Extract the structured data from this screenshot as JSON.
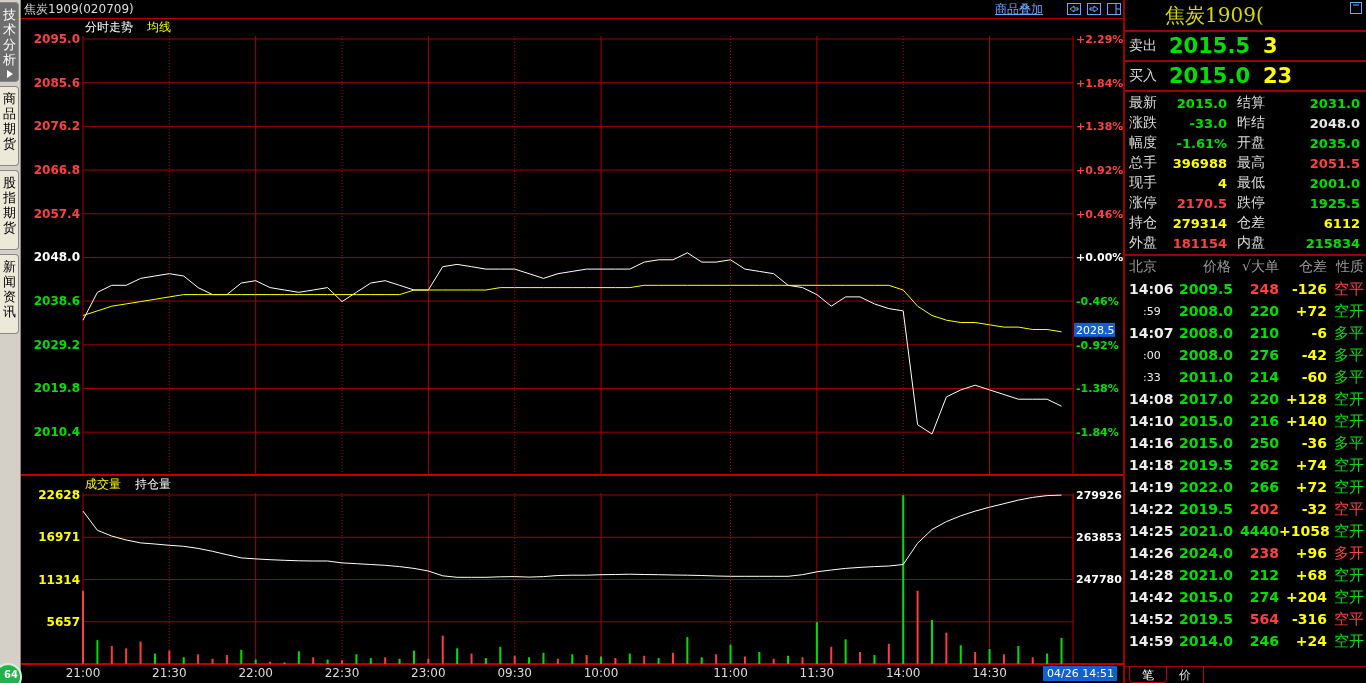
{
  "side_tabs": [
    {
      "label": "技术分析",
      "selected": true
    },
    {
      "label": "商品期货",
      "selected": false
    },
    {
      "label": "股指期货",
      "selected": false
    },
    {
      "label": "新闻资讯",
      "selected": false
    }
  ],
  "float_badge": "64",
  "header": {
    "title": "焦炭1909(020709)",
    "link": "商品叠加"
  },
  "price_panel": {
    "percent_labels": [
      {
        "text": "+2.29%",
        "color": "#ff4040"
      },
      {
        "text": "+1.84%",
        "color": "#ff4040"
      },
      {
        "text": "+1.38%",
        "color": "#ff4040"
      },
      {
        "text": "+0.92%",
        "color": "#ff4040"
      },
      {
        "text": "+0.46%",
        "color": "#ff4040"
      },
      {
        "text": "+0.00%",
        "color": "#ffffff"
      },
      {
        "text": "-0.46%",
        "color": "#00e000"
      },
      {
        "text": "-0.92%",
        "color": "#00e000"
      },
      {
        "text": "-1.38%",
        "color": "#00e000"
      },
      {
        "text": "-1.84%",
        "color": "#00e000"
      }
    ],
    "last_price_badge": "2028.5",
    "chart_data": {
      "type": "line",
      "series": [
        {
          "name": "分时走势",
          "color": "#ffffff",
          "values": [
            2034.5,
            2040.5,
            2042.0,
            2042.0,
            2043.5,
            2044.0,
            2044.5,
            2044.0,
            2041.5,
            2040.0,
            2040.0,
            2042.5,
            2043.0,
            2041.5,
            2041.0,
            2040.5,
            2041.0,
            2041.5,
            2038.5,
            2040.5,
            2042.5,
            2043.0,
            2042.0,
            2041.0,
            2041.0,
            2046.0,
            2046.5,
            2046.0,
            2045.5,
            2045.5,
            2045.5,
            2044.5,
            2043.5,
            2044.5,
            2045.0,
            2045.5,
            2045.5,
            2045.5,
            2045.5,
            2047.0,
            2047.5,
            2047.5,
            2049.0,
            2047.0,
            2047.0,
            2047.5,
            2045.5,
            2045.0,
            2044.5,
            2042.0,
            2041.5,
            2040.0,
            2037.5,
            2039.5,
            2039.5,
            2038.0,
            2037.0,
            2036.5,
            2012.0,
            2010.0,
            2018.0,
            2019.5,
            2020.5,
            2019.5,
            2018.5,
            2017.5,
            2017.5,
            2017.5,
            2016.0
          ]
        },
        {
          "name": "均线",
          "color": "#ffff00",
          "values": [
            2035.5,
            2036.5,
            2037.5,
            2038.0,
            2038.5,
            2039.0,
            2039.5,
            2040.0,
            2040.0,
            2040.0,
            2040.0,
            2040.0,
            2040.0,
            2040.0,
            2040.0,
            2040.0,
            2040.0,
            2040.0,
            2040.0,
            2040.0,
            2040.0,
            2040.0,
            2040.0,
            2041.0,
            2041.0,
            2041.0,
            2041.0,
            2041.0,
            2041.0,
            2041.5,
            2041.5,
            2041.5,
            2041.5,
            2041.5,
            2041.5,
            2041.5,
            2041.5,
            2041.5,
            2041.5,
            2042.0,
            2042.0,
            2042.0,
            2042.0,
            2042.0,
            2042.0,
            2042.0,
            2042.0,
            2042.0,
            2042.0,
            2042.0,
            2042.0,
            2042.0,
            2042.0,
            2042.0,
            2042.0,
            2042.0,
            2042.0,
            2041.0,
            2037.5,
            2035.5,
            2034.5,
            2034.0,
            2034.0,
            2033.5,
            2033.0,
            2033.0,
            2032.5,
            2032.5,
            2032.0
          ]
        }
      ],
      "grid": true,
      "ylim": [
        2001.4,
        2095.65
      ],
      "yticks": [
        {
          "value": 2095.0,
          "label": "2095.0"
        },
        {
          "value": 2085.6,
          "label": "2085.6"
        },
        {
          "value": 2076.2,
          "label": "2076.2"
        },
        {
          "value": 2066.8,
          "label": "2066.8"
        },
        {
          "value": 2057.4,
          "label": "2057.4"
        },
        {
          "value": 2048.0,
          "label": "2048.0"
        },
        {
          "value": 2038.6,
          "label": "2038.6"
        },
        {
          "value": 2029.2,
          "label": "2029.2"
        },
        {
          "value": 2019.8,
          "label": "2019.8"
        },
        {
          "value": 2010.4,
          "label": "2010.4"
        }
      ]
    }
  },
  "volume_panel": {
    "chart_data": {
      "type": "bar",
      "title": "成交量",
      "categories": [
        "21:00",
        null,
        null,
        null,
        null,
        null,
        "21:30",
        null,
        null,
        null,
        null,
        null,
        "22:00",
        null,
        null,
        null,
        null,
        null,
        "22:30",
        null,
        null,
        null,
        null,
        null,
        "23:00",
        null,
        null,
        null,
        null,
        null,
        "09:30",
        null,
        null,
        null,
        null,
        null,
        "10:00",
        null,
        null,
        null,
        null,
        null,
        null,
        null,
        null,
        "11:00",
        null,
        null,
        null,
        null,
        null,
        "11:30",
        null,
        null,
        null,
        null,
        null,
        "14:00",
        null,
        null,
        null,
        null,
        null,
        "14:30",
        null,
        null,
        null,
        null,
        null
      ],
      "series": [
        {
          "color": "#ff3c3c",
          "values": [
            9800,
            null,
            2400,
            2100,
            3000,
            null,
            1800,
            null,
            1300,
            700,
            1200,
            null,
            null,
            300,
            null,
            null,
            900,
            null,
            500,
            null,
            null,
            900,
            null,
            null,
            700,
            3800,
            null,
            1400,
            null,
            null,
            1100,
            null,
            null,
            700,
            null,
            1200,
            null,
            800,
            null,
            1100,
            null,
            1500,
            null,
            null,
            1300,
            null,
            1000,
            null,
            700,
            null,
            900,
            null,
            2300,
            null,
            1600,
            null,
            2700,
            null,
            9800,
            null,
            4200,
            null,
            1600,
            null,
            1300,
            null,
            900,
            null,
            null
          ]
        },
        {
          "color": "#00e000",
          "values": [
            null,
            3200,
            null,
            null,
            null,
            1400,
            null,
            900,
            null,
            null,
            null,
            1900,
            600,
            null,
            200,
            1700,
            null,
            600,
            null,
            1300,
            800,
            null,
            700,
            1800,
            null,
            null,
            2100,
            null,
            800,
            2300,
            null,
            900,
            1500,
            null,
            1300,
            null,
            1000,
            null,
            1400,
            null,
            800,
            null,
            3600,
            900,
            null,
            2600,
            null,
            1600,
            null,
            1100,
            null,
            5600,
            null,
            3300,
            null,
            1200,
            null,
            22600,
            null,
            5900,
            null,
            2500,
            null,
            2000,
            null,
            2400,
            null,
            1400,
            3500
          ]
        }
      ],
      "stacked": true,
      "grid": true,
      "ylim": [
        0,
        22896
      ],
      "yticks": [
        22628,
        16971,
        11314,
        5657
      ]
    },
    "time_badge": "04/26 14:51"
  },
  "open_interest_panel": {
    "chart_data": {
      "type": "line",
      "title": "持仓量",
      "series": [
        {
          "color": "#ffffff",
          "values": [
            273800,
            266500,
            264300,
            262800,
            261700,
            261300,
            260800,
            260400,
            259600,
            258500,
            257200,
            256000,
            255600,
            255300,
            255100,
            254900,
            254800,
            254800,
            254100,
            253800,
            253500,
            253200,
            252700,
            252000,
            251000,
            249200,
            248600,
            248600,
            248600,
            248800,
            248900,
            248700,
            248900,
            249300,
            249400,
            249400,
            249600,
            249700,
            249800,
            249700,
            249600,
            249500,
            249400,
            249300,
            249100,
            249000,
            249000,
            249000,
            249000,
            249000,
            249600,
            250700,
            251400,
            252000,
            252400,
            252700,
            252900,
            253500,
            261600,
            266800,
            269800,
            272000,
            273800,
            275300,
            276600,
            278000,
            279000,
            279700,
            279900
          ]
        }
      ],
      "ylim": [
        247780,
        279926
      ],
      "yticks": [
        279926,
        263853,
        247780
      ]
    }
  },
  "quote": {
    "title": "焦炭1909(",
    "sell": {
      "label": "卖出",
      "price": "2015.5",
      "volume": "3"
    },
    "buy": {
      "label": "买入",
      "price": "2015.0",
      "volume": "23"
    },
    "stats": [
      {
        "label": "最新",
        "value": "2015.0",
        "color": "#00e000"
      },
      {
        "label": "结算",
        "value": "2031.0",
        "color": "#00e000"
      },
      {
        "label": "涨跌",
        "value": "-33.0",
        "color": "#00e000"
      },
      {
        "label": "昨结",
        "value": "2048.0",
        "color": "#e8e8e8"
      },
      {
        "label": "幅度",
        "value": "-1.61%",
        "color": "#00e000"
      },
      {
        "label": "开盘",
        "value": "2035.0",
        "color": "#00e000"
      },
      {
        "label": "总手",
        "value": "396988",
        "color": "#ffff00"
      },
      {
        "label": "最高",
        "value": "2051.5",
        "color": "#ff4040"
      },
      {
        "label": "现手",
        "value": "4",
        "color": "#ffff00"
      },
      {
        "label": "最低",
        "value": "2001.0",
        "color": "#00e000"
      },
      {
        "label": "涨停",
        "value": "2170.5",
        "color": "#ff4040"
      },
      {
        "label": "跌停",
        "value": "1925.5",
        "color": "#00e000"
      },
      {
        "label": "持仓",
        "value": "279314",
        "color": "#ffff00"
      },
      {
        "label": "仓差",
        "value": "6112",
        "color": "#ffff00"
      },
      {
        "label": "外盘",
        "value": "181154",
        "color": "#ff4040"
      },
      {
        "label": "内盘",
        "value": "215834",
        "color": "#00e000"
      }
    ],
    "tick_columns": [
      "北京",
      "价格",
      "√大单",
      "仓差",
      "性质"
    ],
    "ticks": [
      {
        "time": "14:06",
        "kind": "minute",
        "price": "2009.5",
        "volume": "248",
        "change": "-126",
        "nature": "空平",
        "color": "#ff4040"
      },
      {
        "time": ":59",
        "kind": "second",
        "price": "2008.0",
        "volume": "220",
        "change": "+72",
        "nature": "空开",
        "color": "#00e000"
      },
      {
        "time": "14:07",
        "kind": "minute",
        "price": "2008.0",
        "volume": "210",
        "change": "-6",
        "nature": "多平",
        "color": "#00e000"
      },
      {
        "time": ":00",
        "kind": "second",
        "price": "2008.0",
        "volume": "276",
        "change": "-42",
        "nature": "多平",
        "color": "#00e000"
      },
      {
        "time": ":33",
        "kind": "second",
        "price": "2011.0",
        "volume": "214",
        "change": "-60",
        "nature": "多平",
        "color": "#00e000"
      },
      {
        "time": "14:08",
        "kind": "minute",
        "price": "2017.0",
        "volume": "220",
        "change": "+128",
        "nature": "空开",
        "color": "#00e000"
      },
      {
        "time": "14:10",
        "kind": "minute",
        "price": "2015.0",
        "volume": "216",
        "change": "+140",
        "nature": "空开",
        "color": "#00e000"
      },
      {
        "time": "14:16",
        "kind": "minute",
        "price": "2015.0",
        "volume": "250",
        "change": "-36",
        "nature": "多平",
        "color": "#00e000"
      },
      {
        "time": "14:18",
        "kind": "minute",
        "price": "2019.5",
        "volume": "262",
        "change": "+74",
        "nature": "空开",
        "color": "#00e000"
      },
      {
        "time": "14:19",
        "kind": "minute",
        "price": "2022.0",
        "volume": "266",
        "change": "+72",
        "nature": "空开",
        "color": "#00e000"
      },
      {
        "time": "14:22",
        "kind": "minute",
        "price": "2019.5",
        "volume": "202",
        "change": "-32",
        "nature": "空平",
        "color": "#ff4040"
      },
      {
        "time": "14:25",
        "kind": "minute",
        "price": "2021.0",
        "volume": "4440",
        "change": "+1058",
        "nature": "空开",
        "color": "#00e000"
      },
      {
        "time": "14:26",
        "kind": "minute",
        "price": "2024.0",
        "volume": "238",
        "change": "+96",
        "nature": "多开",
        "color": "#ff4040"
      },
      {
        "time": "14:28",
        "kind": "minute",
        "price": "2021.0",
        "volume": "212",
        "change": "+68",
        "nature": "空开",
        "color": "#00e000"
      },
      {
        "time": "14:42",
        "kind": "minute",
        "price": "2015.0",
        "volume": "274",
        "change": "+204",
        "nature": "空开",
        "color": "#00e000"
      },
      {
        "time": "14:52",
        "kind": "minute",
        "price": "2019.5",
        "volume": "564",
        "change": "-316",
        "nature": "空平",
        "color": "#ff4040"
      },
      {
        "time": "14:59",
        "kind": "minute",
        "price": "2014.0",
        "volume": "246",
        "change": "+24",
        "nature": "空开",
        "color": "#00e000"
      }
    ],
    "bottom_tabs": [
      {
        "label": "笔",
        "selected": true
      },
      {
        "label": "价",
        "selected": false
      }
    ]
  }
}
